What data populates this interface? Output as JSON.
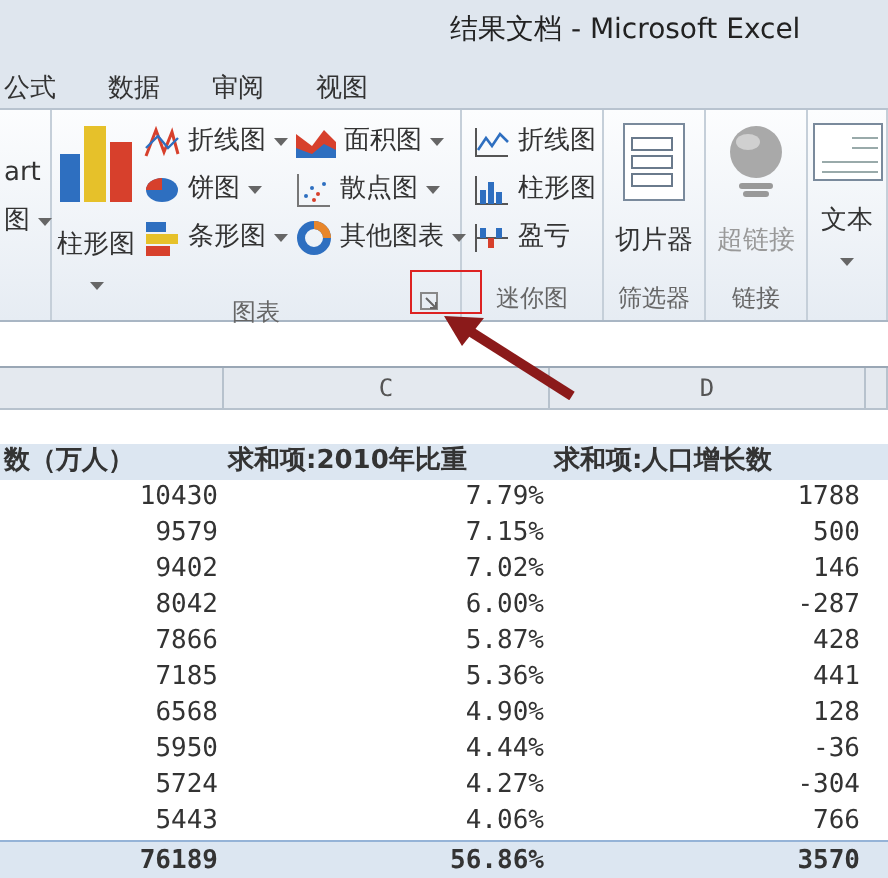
{
  "window": {
    "title": "结果文档 - Microsoft Excel"
  },
  "tabs": [
    {
      "label": "公式",
      "selected": false
    },
    {
      "label": "数据",
      "selected": false
    },
    {
      "label": "审阅",
      "selected": false
    },
    {
      "label": "视图",
      "selected": false
    }
  ],
  "ribbon": {
    "groups": [
      {
        "items": [
          {
            "kind": "small",
            "label": "art",
            "dropdown": false
          },
          {
            "kind": "small",
            "label": "图",
            "dropdown": true
          }
        ]
      },
      {
        "label": "图表",
        "launcher": true,
        "items": [
          {
            "kind": "large",
            "label": "柱形图",
            "dropdown": true
          },
          {
            "kind": "small",
            "label": "折线图",
            "dropdown": true
          },
          {
            "kind": "small",
            "label": "饼图",
            "dropdown": true
          },
          {
            "kind": "small",
            "label": "条形图",
            "dropdown": true
          },
          {
            "kind": "small",
            "label": "面积图",
            "dropdown": true
          },
          {
            "kind": "small",
            "label": "散点图",
            "dropdown": true
          },
          {
            "kind": "small",
            "label": "其他图表",
            "dropdown": true
          }
        ]
      },
      {
        "label": "迷你图",
        "items": [
          {
            "kind": "small",
            "label": "折线图",
            "dropdown": false
          },
          {
            "kind": "small",
            "label": "柱形图",
            "dropdown": false
          },
          {
            "kind": "small",
            "label": "盈亏",
            "dropdown": false
          }
        ]
      },
      {
        "label": "筛选器",
        "items": [
          {
            "kind": "large",
            "label": "切片器",
            "dropdown": false,
            "disabled": false
          }
        ]
      },
      {
        "label": "链接",
        "items": [
          {
            "kind": "large",
            "label": "超链接",
            "dropdown": false,
            "disabled": true
          }
        ]
      },
      {
        "items": [
          {
            "kind": "large",
            "label": "文本",
            "dropdown": true,
            "disabled": false
          }
        ]
      }
    ]
  },
  "sheet": {
    "columns": [
      "",
      "C",
      "D"
    ],
    "header": [
      "数（万人）",
      "求和项:2010年比重",
      "求和项:人口增长数"
    ],
    "rows": [
      [
        "10430",
        "7.79%",
        "1788"
      ],
      [
        "9579",
        "7.15%",
        "500"
      ],
      [
        "9402",
        "7.02%",
        "146"
      ],
      [
        "8042",
        "6.00%",
        "-287"
      ],
      [
        "7866",
        "5.87%",
        "428"
      ],
      [
        "7185",
        "5.36%",
        "441"
      ],
      [
        "6568",
        "4.90%",
        "128"
      ],
      [
        "5950",
        "4.44%",
        "-36"
      ],
      [
        "5724",
        "4.27%",
        "-304"
      ],
      [
        "5443",
        "4.06%",
        "766"
      ]
    ],
    "total": [
      "76189",
      "56.86%",
      "3570"
    ]
  }
}
